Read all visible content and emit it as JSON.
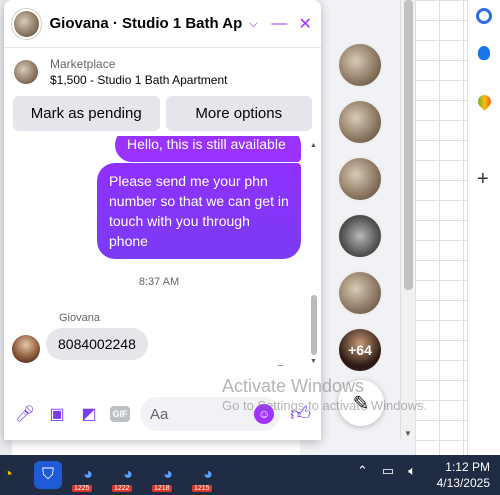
{
  "chat": {
    "title": "Giovana · Studio 1 Bath Ap...",
    "listing_label": "Marketplace",
    "listing_title": "$1,500 - Studio 1 Bath Apartment",
    "mark_pending": "Mark as pending",
    "more_options": "More options",
    "messages": {
      "out1": "Hello, this is still available",
      "out2": "Please send me your phn number so that we can get in touch with you through phone",
      "time": "8:37 AM",
      "sender": "Giovana",
      "in1": "8084002248"
    },
    "composer_placeholder": "Aa",
    "gif_label": "GIF"
  },
  "heads": {
    "more_count": "+64"
  },
  "watermark": {
    "line1": "Activate Windows",
    "line2": "Go to Settings to activate Windows."
  },
  "taskbar": {
    "badges": [
      "1225",
      "1222",
      "1218",
      "1215"
    ],
    "time": "1:12 PM",
    "date": "4/13/2025"
  },
  "colors": {
    "accent": "#a033ff",
    "taskbar": "#1f2c43"
  }
}
